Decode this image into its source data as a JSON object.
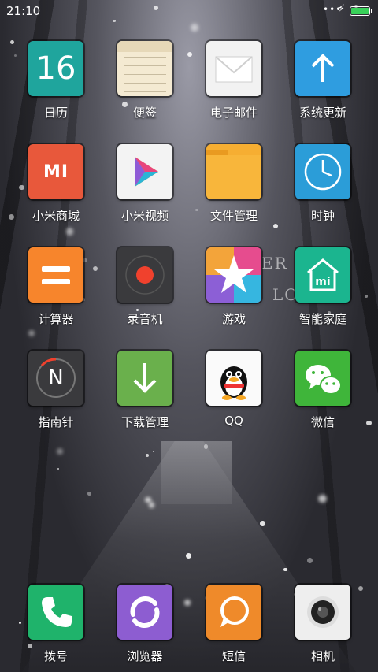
{
  "status": {
    "time": "21:10",
    "battery_level": 1.0,
    "battery_color": "#39d15a"
  },
  "wallpaper_text": {
    "line1": "ER S",
    "line2": "LOV"
  },
  "apps": [
    {
      "label": "日历",
      "icon": "calendar-icon",
      "color": "#1fa59d",
      "glyph": "16"
    },
    {
      "label": "便签",
      "icon": "notes-icon",
      "color": "#f4ead2"
    },
    {
      "label": "电子邮件",
      "icon": "email-icon",
      "color": "#f2f2f2"
    },
    {
      "label": "系统更新",
      "icon": "update-icon",
      "color": "#2f9de0"
    },
    {
      "label": "小米商城",
      "icon": "mi-store-icon",
      "color": "#e8583b",
      "glyph": "MI"
    },
    {
      "label": "小米视频",
      "icon": "mi-video-icon",
      "color": "#f3f3f3"
    },
    {
      "label": "文件管理",
      "icon": "folder-icon",
      "color": "#f6ae32"
    },
    {
      "label": "时钟",
      "icon": "clock-icon",
      "color": "#2b9dd8"
    },
    {
      "label": "计算器",
      "icon": "calculator-icon",
      "color": "#f7852c"
    },
    {
      "label": "录音机",
      "icon": "recorder-icon",
      "color": "#3a3a3d"
    },
    {
      "label": "游戏",
      "icon": "games-icon",
      "color": "#e64c8e"
    },
    {
      "label": "智能家庭",
      "icon": "smart-home-icon",
      "color": "#1bb58f"
    },
    {
      "label": "指南针",
      "icon": "compass-icon",
      "color": "#3a3a3d",
      "glyph": "N"
    },
    {
      "label": "下载管理",
      "icon": "download-icon",
      "color": "#6ab04c"
    },
    {
      "label": "QQ",
      "icon": "qq-icon",
      "color": "#fafafa"
    },
    {
      "label": "微信",
      "icon": "wechat-icon",
      "color": "#3fb53a"
    }
  ],
  "dock": [
    {
      "label": "拨号",
      "icon": "phone-icon",
      "color": "#1fb36b"
    },
    {
      "label": "浏览器",
      "icon": "browser-icon",
      "color": "#8d5dd1"
    },
    {
      "label": "短信",
      "icon": "sms-icon",
      "color": "#ef8a2a"
    },
    {
      "label": "相机",
      "icon": "camera-icon",
      "color": "#eeeeee"
    }
  ]
}
